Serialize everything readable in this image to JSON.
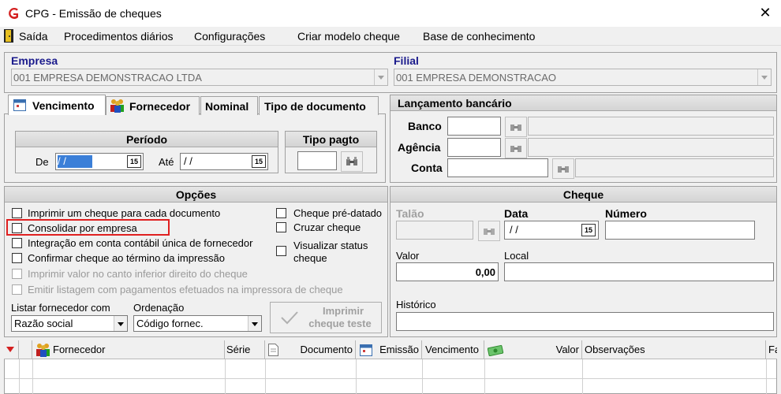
{
  "window": {
    "title": "CPG - Emissão de cheques",
    "close_glyph": "✕"
  },
  "menu": {
    "items": [
      "Saída",
      "Procedimentos diários",
      "Configurações",
      "Criar modelo cheque",
      "Base de conhecimento"
    ]
  },
  "empresa": {
    "label": "Empresa",
    "value": "001 EMPRESA DEMONSTRACAO LTDA"
  },
  "filial": {
    "label": "Filial",
    "value": "001 EMPRESA DEMONSTRACAO"
  },
  "tabs": [
    "Vencimento",
    "Fornecedor",
    "Nominal",
    "Tipo de documento"
  ],
  "periodo": {
    "title": "Período",
    "de_label": "De",
    "de_value": " / /",
    "ate_label": "Até",
    "ate_value": " / /",
    "cal_glyph": "15"
  },
  "tipo_pagto": {
    "title": "Tipo pagto",
    "value": ""
  },
  "lancamento": {
    "title": "Lançamento bancário",
    "banco_label": "Banco",
    "agencia_label": "Agência",
    "conta_label": "Conta"
  },
  "opcoes": {
    "title": "Opções",
    "checks_left": [
      {
        "label": "Imprimir um cheque para cada documento",
        "enabled": true
      },
      {
        "label": "Consolidar por empresa",
        "enabled": true
      },
      {
        "label": "Integração em conta contábil única de fornecedor",
        "enabled": true
      },
      {
        "label": "Confirmar cheque ao término da impressão",
        "enabled": true
      },
      {
        "label": "Imprimir valor no canto inferior direito do cheque",
        "enabled": false
      },
      {
        "label": "Emitir listagem com pagamentos efetuados na impressora de cheque",
        "enabled": false
      }
    ],
    "checks_right": [
      {
        "label": "Cheque pré-datado"
      },
      {
        "label": "Cruzar cheque"
      },
      {
        "label_line1": "Visualizar status",
        "label_line2": "cheque"
      }
    ],
    "listar_label": "Listar fornecedor com",
    "listar_value": "Razão social",
    "ordenacao_label": "Ordenação",
    "ordenacao_value": "Código fornec.",
    "imprimir_teste_line1": "Imprimir",
    "imprimir_teste_line2": "cheque teste",
    "highlight_color": "#e02020"
  },
  "cheque": {
    "title": "Cheque",
    "talao_label": "Talão",
    "data_label": "Data",
    "data_value": " / /",
    "numero_label": "Número",
    "valor_label": "Valor",
    "valor_value": "0,00",
    "local_label": "Local",
    "historico_label": "Histórico"
  },
  "grid": {
    "columns": [
      "Fornecedor",
      "Série",
      "Documento",
      "Emissão",
      "Vencimento",
      "Valor",
      "Observações",
      "Fa"
    ]
  },
  "colors": {
    "accent_blue": "#1a1a8c",
    "selection_blue": "#3b7fd8",
    "icon_red": "#d42020"
  }
}
